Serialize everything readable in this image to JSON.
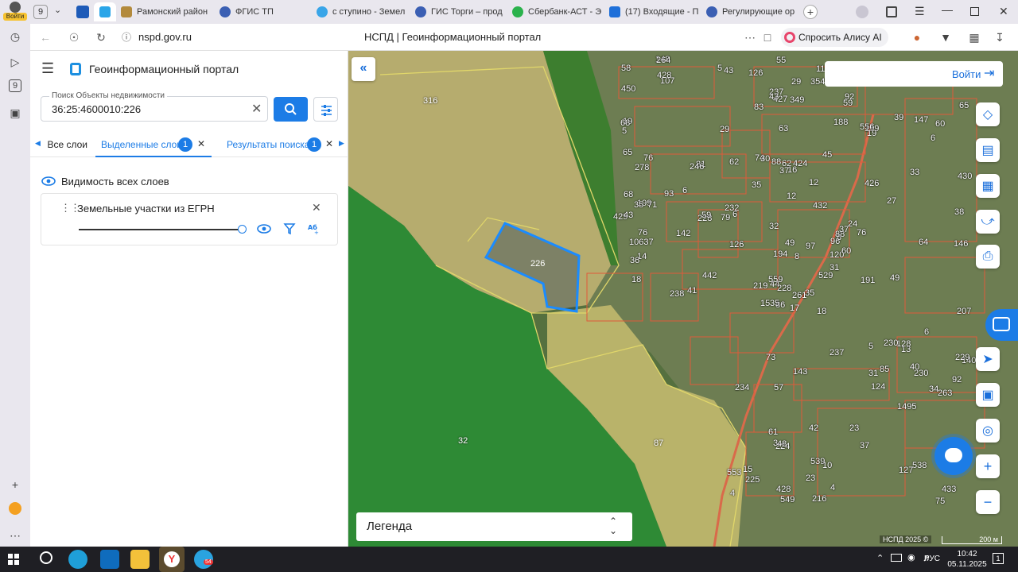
{
  "browser": {
    "profile_label": "Войти",
    "tab_count": "9",
    "tabs": [
      {
        "title": "Рамонский район"
      },
      {
        "title": "ФГИС ТП"
      },
      {
        "title": "с ступино - Земел"
      },
      {
        "title": "ГИС Торги – прод"
      },
      {
        "title": "Сбербанк-АСТ - Э"
      },
      {
        "title": "(17) Входящие - П"
      },
      {
        "title": "Регулирующие ор"
      }
    ],
    "address": "nspd.gov.ru",
    "page_title": "НСПД | Геоинформационный портал",
    "alice_label": "Спросить Алису AI",
    "rail_badge": "9"
  },
  "panel": {
    "app_title": "Геоинформационный портал",
    "search": {
      "label": "Поиск Объекты недвижимости",
      "value": "36:25:4600010:226"
    },
    "tabs": [
      {
        "label": "Все слои"
      },
      {
        "label": "Выделенные слои",
        "badge": "1"
      },
      {
        "label": "Результаты поиска",
        "badge": "1"
      }
    ],
    "visibility_label": "Видимость всех слоев",
    "layer": {
      "name": "Земельные участки из ЕГРН",
      "opacity": 1.0
    }
  },
  "map": {
    "login_label": "Войти",
    "legend_label": "Легенда",
    "copyright": "НСПД 2025 ©",
    "scale_label": "200 м",
    "selected_parcel_label": "226",
    "field_labels": [
      "316",
      "32",
      "87"
    ],
    "parcel_labels": [
      "17",
      "278",
      "44",
      "96",
      "424",
      "159",
      "529",
      "107",
      "14",
      "15",
      "426",
      "88",
      "432",
      "6",
      "62",
      "8",
      "13",
      "76",
      "427",
      "5",
      "559",
      "61",
      "194",
      "81",
      "39",
      "433",
      "128",
      "119",
      "79",
      "142",
      "124",
      "120",
      "224",
      "31",
      "430",
      "85",
      "37",
      "428",
      "58",
      "42",
      "60",
      "29",
      "442",
      "429",
      "6",
      "147",
      "148",
      "92",
      "83",
      "49",
      "57",
      "553",
      "230",
      "228",
      "450",
      "93",
      "32",
      "539",
      "97",
      "191",
      "140",
      "428",
      "146",
      "143",
      "538",
      "216",
      "23",
      "237",
      "76",
      "1495",
      "8",
      "92",
      "549",
      "556",
      "19",
      "238",
      "5",
      "88",
      "6",
      "126",
      "207",
      "5",
      "16",
      "219",
      "43",
      "86",
      "65",
      "74",
      "126",
      "12",
      "62",
      "49",
      "225",
      "64",
      "65",
      "4",
      "59",
      "29",
      "230",
      "232",
      "18",
      "76",
      "34",
      "35",
      "37",
      "19",
      "15",
      "127",
      "3",
      "43",
      "38",
      "246",
      "4",
      "6",
      "354",
      "63",
      "12",
      "41",
      "45",
      "237",
      "349",
      "55",
      "59",
      "68",
      "73",
      "264",
      "75",
      "263",
      "10",
      "24",
      "188",
      "31",
      "199",
      "261",
      "23",
      "43",
      "68",
      "71",
      "35",
      "10637",
      "228",
      "229",
      "234",
      "37",
      "33",
      "60",
      "48",
      "18",
      "30",
      "40",
      "36",
      "35",
      "27",
      "35"
    ]
  },
  "taskbar": {
    "lang": "РУС",
    "time": "10:42",
    "date": "05.11.2025",
    "notif_count": "1",
    "yandex_badge": "54"
  }
}
